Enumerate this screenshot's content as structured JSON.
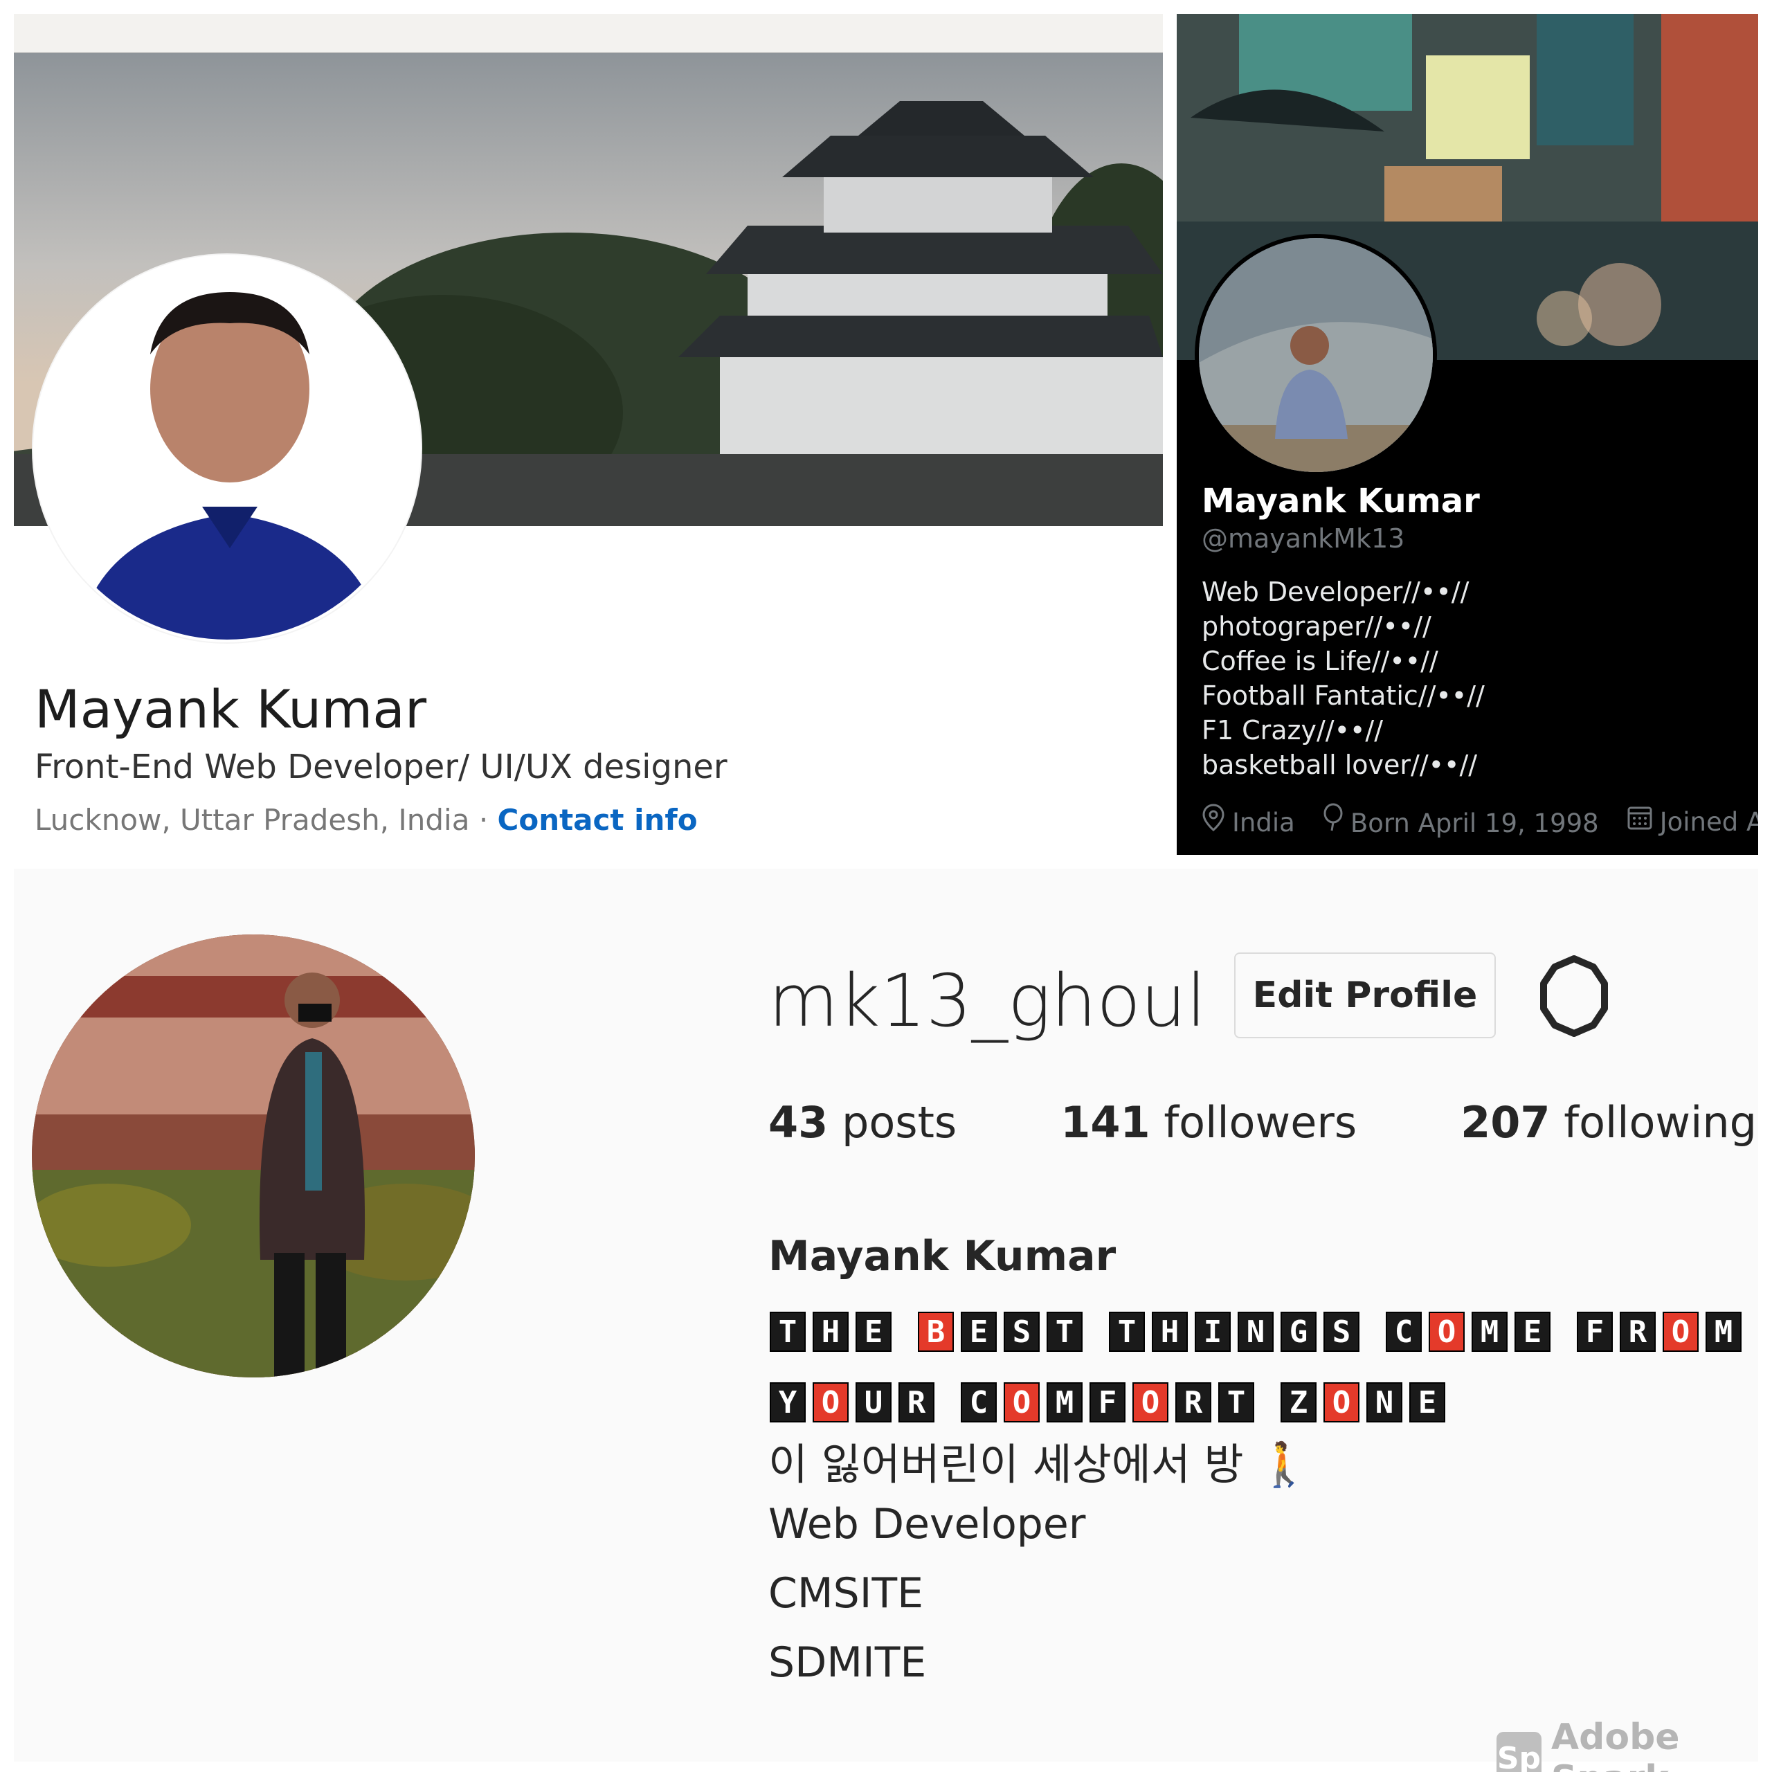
{
  "linkedin": {
    "name": "Mayank Kumar",
    "headline": "Front-End Web Developer/ UI/UX designer",
    "location": "Lucknow, Uttar Pradesh, India",
    "separator": " · ",
    "contact_link": "Contact info",
    "link_color": "#0a66c2"
  },
  "twitter": {
    "name": "Mayank Kumar",
    "handle": "@mayankMk13",
    "bio_lines": [
      "Web Developer//••//",
      "photograper//••//",
      "Coffee is Life//••//",
      "Football Fantatic//••//",
      "F1 Crazy//••//",
      "basketball lover//••//"
    ],
    "location": "India",
    "born": "Born April 19, 1998",
    "joined": "Joined Apr",
    "icons": [
      "location-pin-icon",
      "balloon-icon",
      "calendar-icon"
    ]
  },
  "instagram": {
    "username": "mk13_ghoul",
    "edit_button": "Edit Profile",
    "posts_count": "43",
    "posts_label": "posts",
    "followers_count": "141",
    "followers_label": "followers",
    "following_count": "207",
    "following_label": "following",
    "full_name": "Mayank Kumar",
    "bio_blocks_line1": "THE BEST THINGS COME FROM",
    "bio_blocks_line2": "YOUR COMFORT ZONE",
    "bio_korean": "이 잃어버린이 세상에서 방 🚶",
    "bio_line3": "Web Developer",
    "bio_line4": "CMSITE",
    "bio_line5": "SDMITE"
  },
  "watermark": {
    "logo": "Sp",
    "text": "Adobe Spark"
  }
}
